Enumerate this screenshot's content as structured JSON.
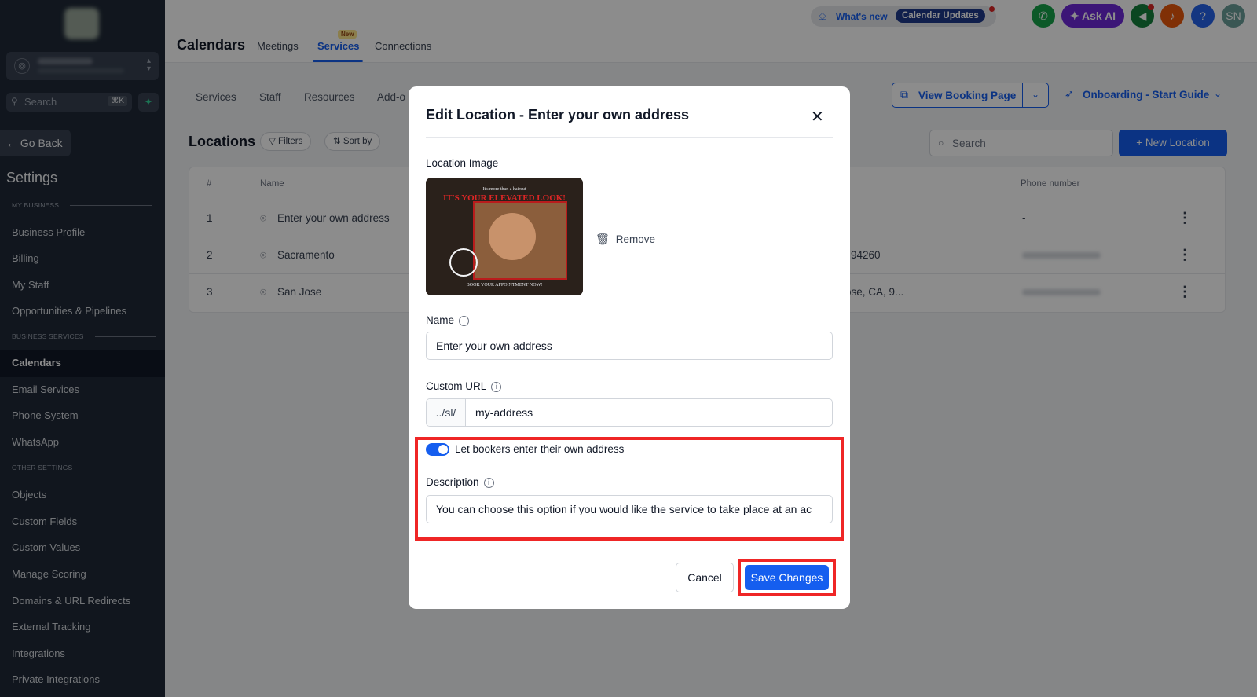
{
  "sidebar": {
    "search_placeholder": "Search",
    "search_shortcut": "⌘K",
    "go_back": "Go Back",
    "settings_title": "Settings",
    "sections": {
      "my_business": "MY BUSINESS",
      "business_services": "BUSINESS SERVICES",
      "other_settings": "OTHER SETTINGS"
    },
    "items": [
      "Business Profile",
      "Billing",
      "My Staff",
      "Opportunities & Pipelines",
      "Calendars",
      "Email Services",
      "Phone System",
      "WhatsApp",
      "Objects",
      "Custom Fields",
      "Custom Values",
      "Manage Scoring",
      "Domains & URL Redirects",
      "External Tracking",
      "Integrations",
      "Private Integrations"
    ],
    "active_item": "Calendars"
  },
  "topbar": {
    "title": "Calendars",
    "tabs": [
      "Meetings",
      "Services",
      "Connections"
    ],
    "active_tab": "Services",
    "new_badge": "New",
    "whats_new": "What's new",
    "calendar_updates": "Calendar Updates",
    "ask_ai": "Ask AI",
    "help": "?",
    "avatar": "SN"
  },
  "subheader": {
    "tabs": [
      "Services",
      "Staff",
      "Resources",
      "Add-o"
    ],
    "view_booking_page": "View Booking Page",
    "onboarding": "Onboarding - Start Guide"
  },
  "locations": {
    "title": "Locations",
    "filters": "Filters",
    "sort_by": "Sort by",
    "search_placeholder": "Search",
    "new_location": "+ New Location",
    "columns": [
      "#",
      "Name",
      "Phone number"
    ],
    "rows": [
      {
        "num": "1",
        "name": "Enter your own address",
        "address": "",
        "phone": "-"
      },
      {
        "num": "2",
        "name": "Sacramento",
        "address": "94260",
        "phone": ""
      },
      {
        "num": "3",
        "name": "San Jose",
        "address": "ose, CA, 9...",
        "phone": ""
      }
    ]
  },
  "modal": {
    "title": "Edit Location - Enter your own address",
    "location_image_label": "Location Image",
    "image_caption_top": "It's more than a haircut",
    "image_caption_main": "IT'S YOUR ELEVATED LOOK!",
    "image_caption_bottom": "BOOK YOUR APPOINTMENT NOW!",
    "remove": "Remove",
    "name_label": "Name",
    "name_value": "Enter your own address",
    "custom_url_label": "Custom URL",
    "custom_url_prefix": "../sl/",
    "custom_url_value": "my-address",
    "toggle_label": "Let bookers enter their own address",
    "toggle_on": true,
    "description_label": "Description",
    "description_value": "You can choose this option if you would like the service to take place at an ac",
    "cancel": "Cancel",
    "save": "Save Changes"
  },
  "colors": {
    "primary": "#155eef",
    "sidebar_bg": "#1f2937",
    "highlight": "#ef2626"
  }
}
